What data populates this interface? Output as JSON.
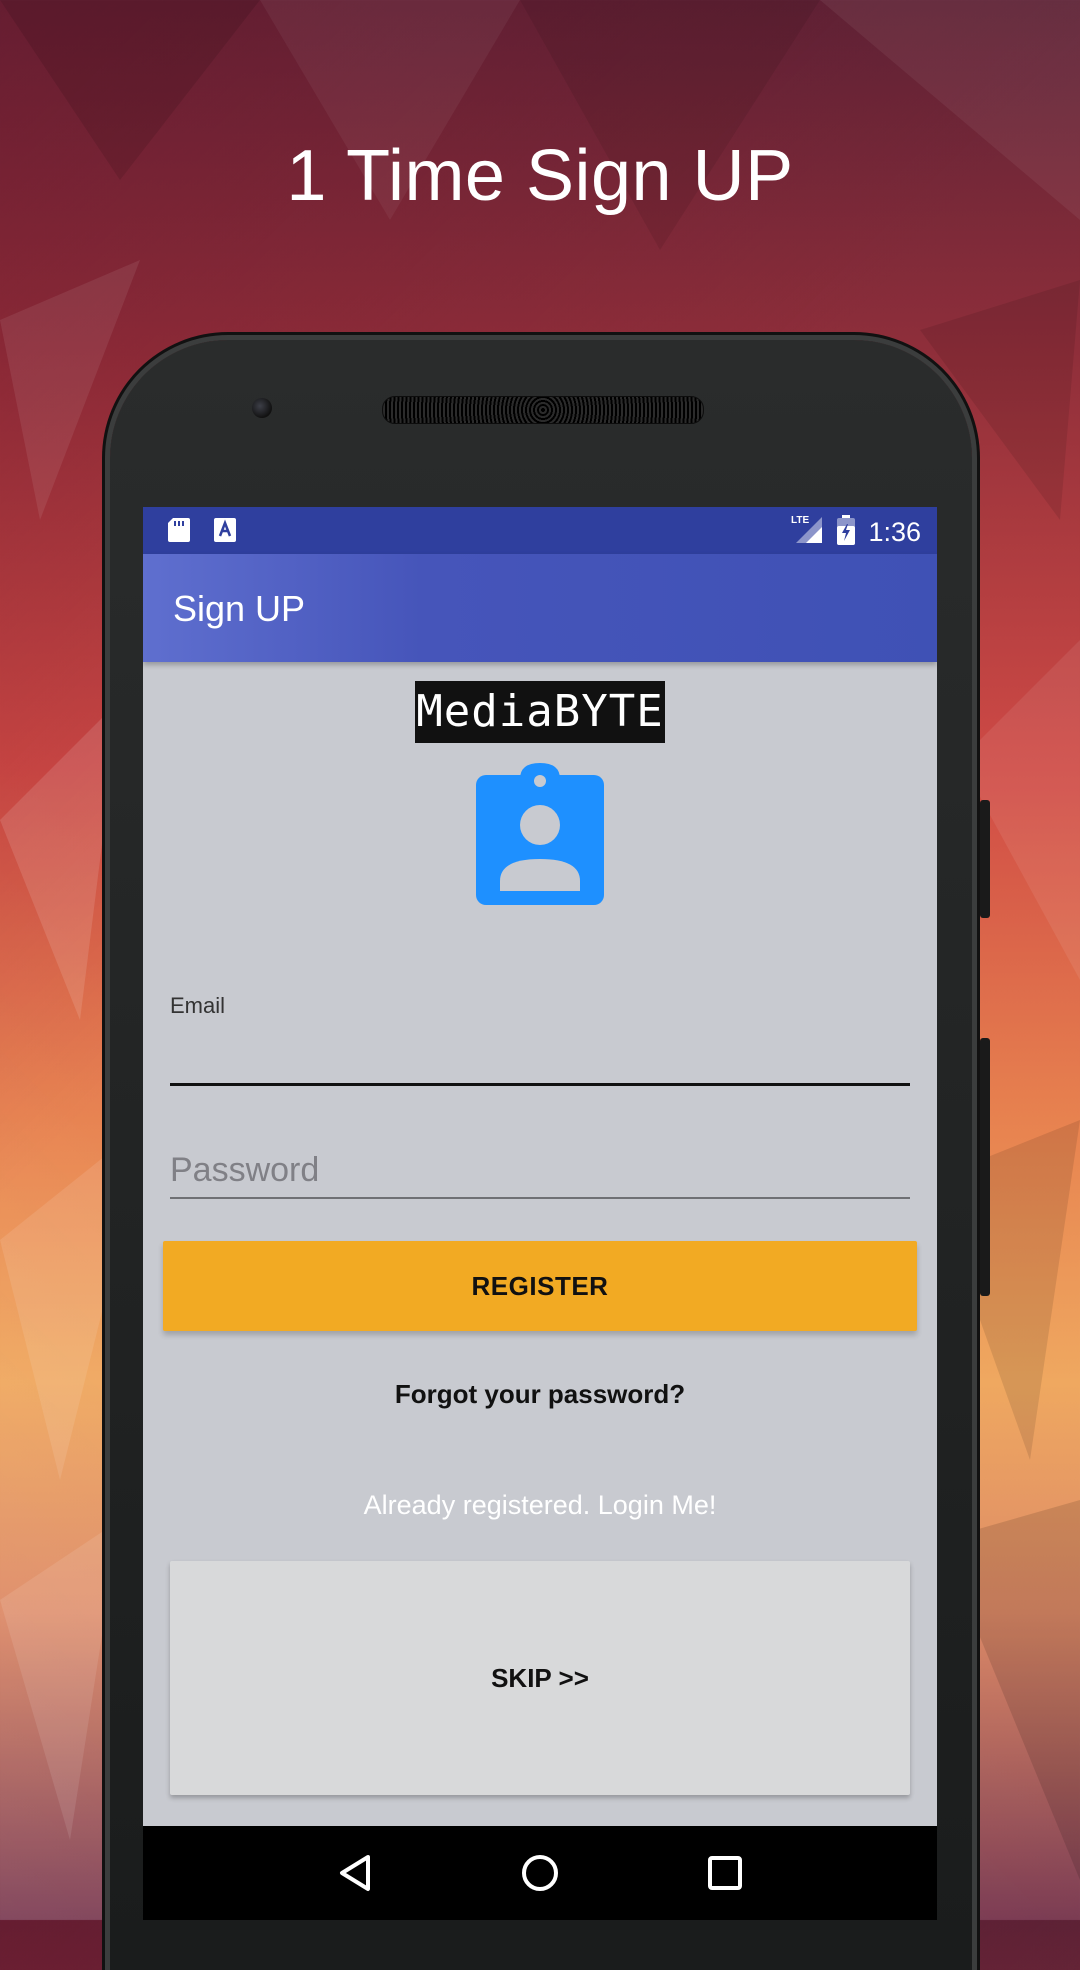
{
  "promo": {
    "title": "1 Time Sign UP"
  },
  "status_bar": {
    "time": "1:36",
    "network_label": "LTE",
    "icons": [
      "sd-card-icon",
      "font-a-icon",
      "lte-signal-icon",
      "battery-charging-icon"
    ]
  },
  "app_bar": {
    "title": "Sign UP"
  },
  "brand": {
    "name": "MediaBYTE"
  },
  "form": {
    "email_label": "Email",
    "email_value": "",
    "password_placeholder": "Password",
    "register_label": "REGISTER",
    "forgot_label": "Forgot your password?",
    "login_label": "Already registered. Login Me!",
    "skip_label": "SKIP >>"
  },
  "nav_bar": {
    "buttons": [
      "back-icon",
      "home-icon",
      "recents-icon"
    ]
  },
  "colors": {
    "primary": "#3f51b5",
    "status_bar": "#2f3f9e",
    "accent_button": "#f2aa23",
    "icon_blue": "#1e90ff"
  }
}
